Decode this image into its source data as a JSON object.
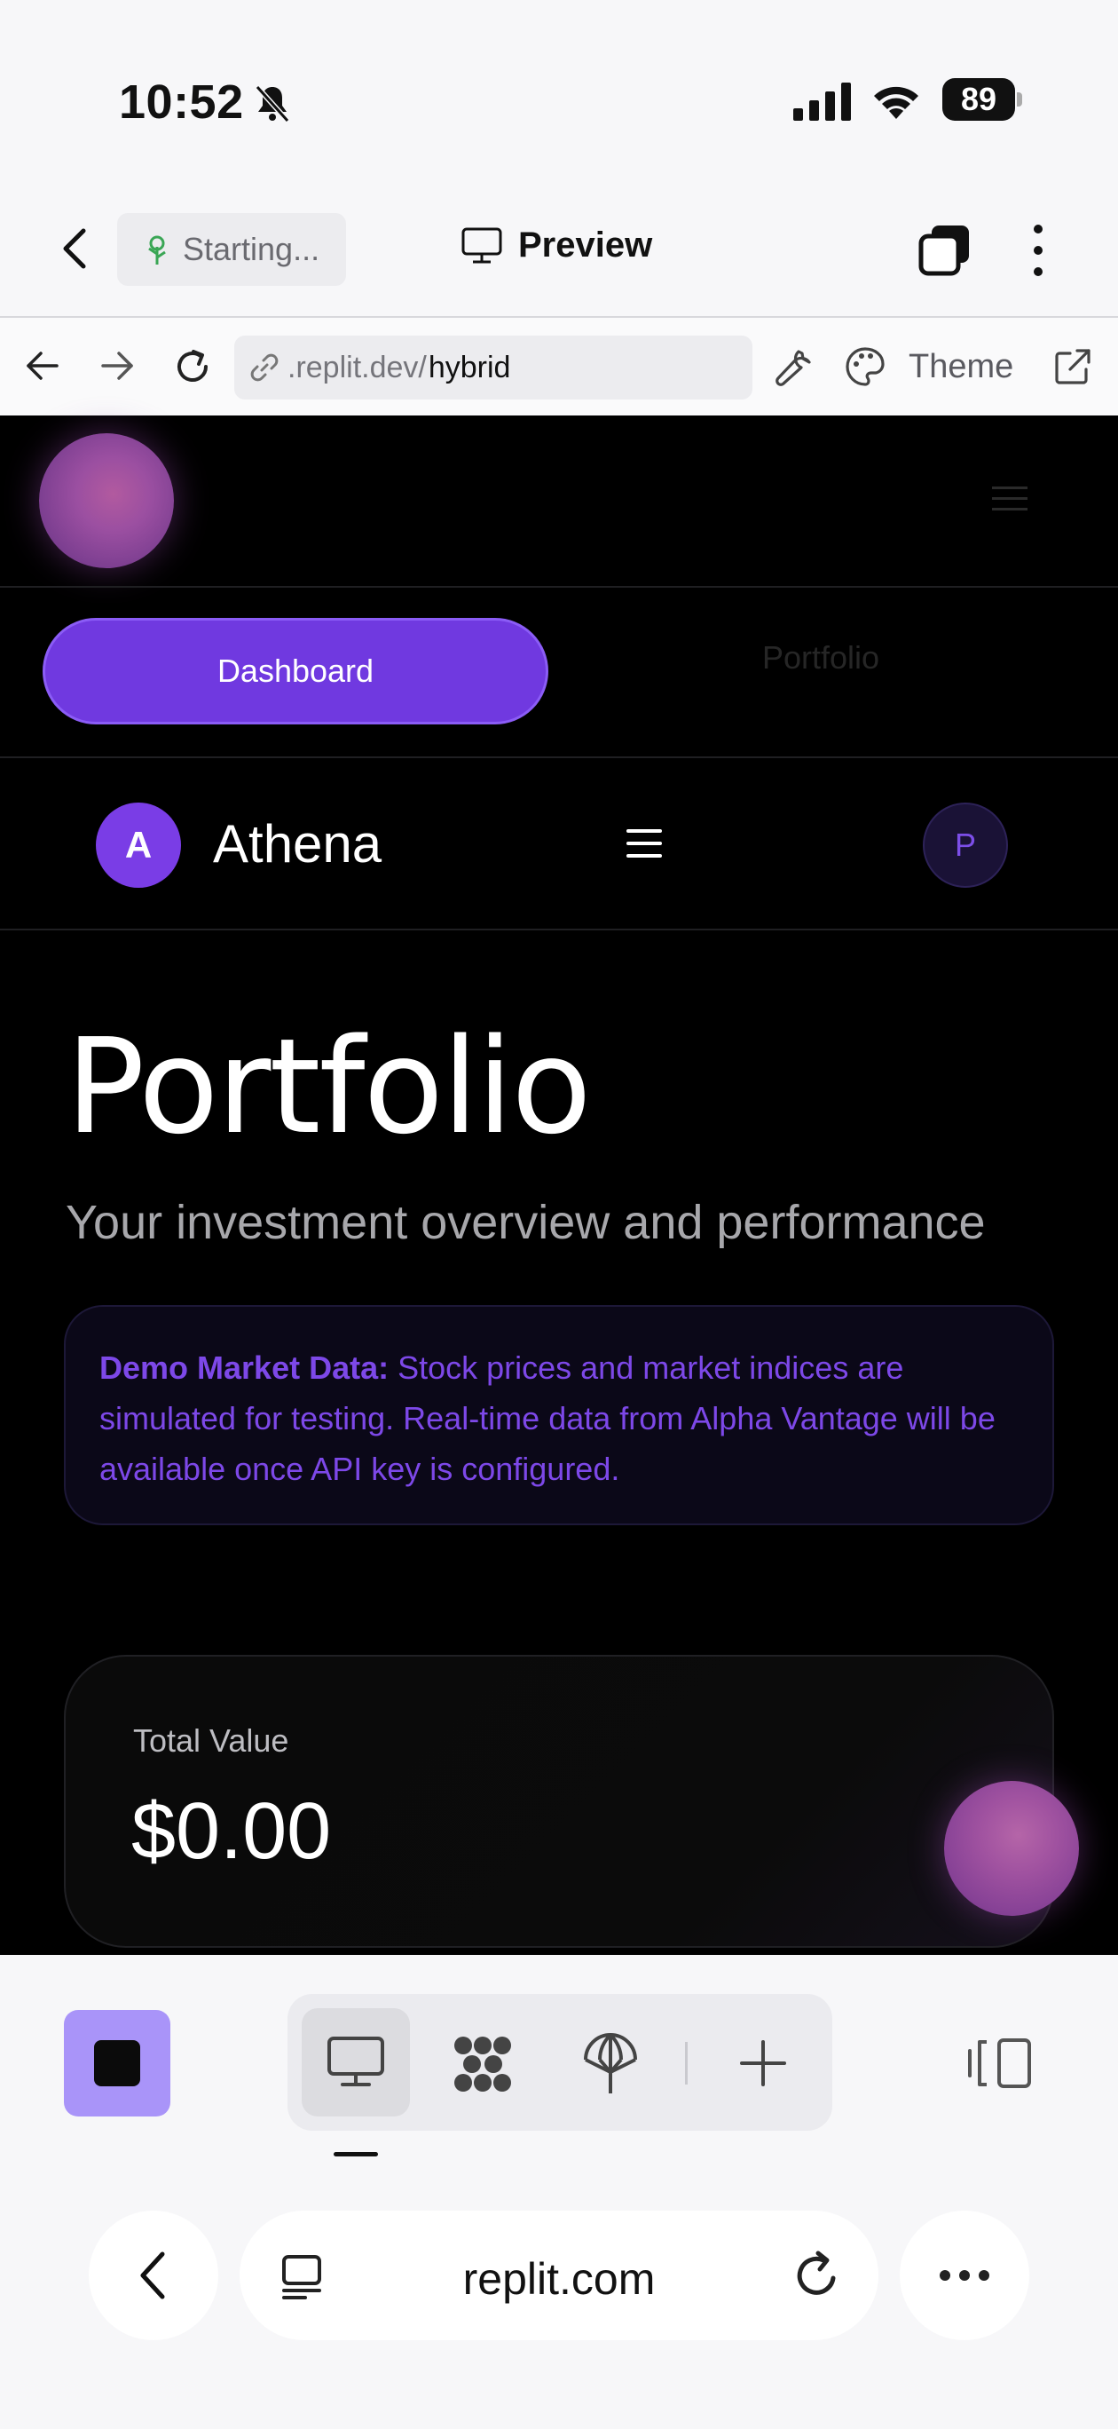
{
  "status_bar": {
    "time": "10:52",
    "battery": "89"
  },
  "replit_header": {
    "starting_label": "Starting...",
    "preview_label": "Preview"
  },
  "url_bar": {
    "url_prefix": ".replit.dev/",
    "url_path": "hybrid",
    "theme_label": "Theme"
  },
  "app": {
    "tabs": [
      {
        "label": "Dashboard",
        "active": true
      },
      {
        "label": "Portfolio",
        "active": false
      }
    ],
    "brand": {
      "avatar_letter": "A",
      "name": "Athena"
    },
    "profile_letter": "P",
    "page_title": "Portfolio",
    "page_subtitle": "Your investment overview and performance",
    "notice": {
      "bold": "Demo Market Data:",
      "text": " Stock prices and market indices are simulated for testing. Real-time data from Alpha Vantage will be available once API key is configured."
    },
    "total_value": {
      "label": "Total Value",
      "amount": "$0.00"
    }
  },
  "browser": {
    "domain": "replit.com"
  },
  "colors": {
    "accent": "#7039e0",
    "notice_text": "#7d48e8",
    "stop_button": "#a994f9",
    "app_background": "#000000"
  },
  "icons": [
    "bell-slash-icon",
    "signal-icon",
    "wifi-icon",
    "battery-icon",
    "chevron-left-icon",
    "sprout-icon",
    "monitor-icon",
    "tabs-icon",
    "kebab-icon",
    "arrow-left-icon",
    "arrow-right-icon",
    "reload-icon",
    "link-icon",
    "wrench-icon",
    "palette-icon",
    "external-link-icon",
    "menu-icon",
    "stop-icon",
    "flower-icon",
    "deploy-icon",
    "plus-icon",
    "side-panel-icon",
    "more-icon"
  ]
}
